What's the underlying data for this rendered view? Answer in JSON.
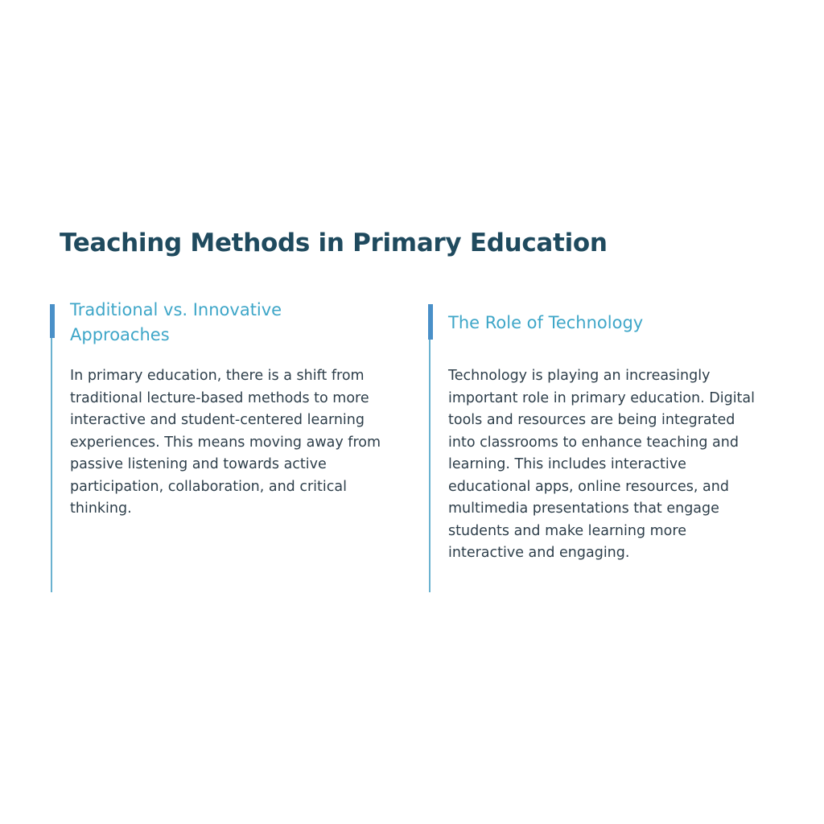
{
  "page": {
    "title": "Teaching Methods in Primary Education"
  },
  "columns": [
    {
      "heading": "Traditional vs. Innovative Approaches",
      "body": "In primary education, there is a shift from traditional lecture-based methods to more interactive and student-centered learning experiences. This means moving away from passive listening and towards active participation, collaboration, and critical thinking."
    },
    {
      "heading": "The Role of Technology",
      "body": "Technology is playing an increasingly important role in primary education. Digital tools and resources are being integrated into classrooms to enhance teaching and learning. This includes interactive educational apps, online resources, and multimedia presentations that engage students and make learning more interactive and engaging."
    }
  ],
  "colors": {
    "title": "#1f4a5e",
    "heading": "#3ea6c8",
    "body": "#2d3e4a",
    "accent_bar": "#4a90c8",
    "divider": "#6ab2d0",
    "background": "#ffffff"
  }
}
